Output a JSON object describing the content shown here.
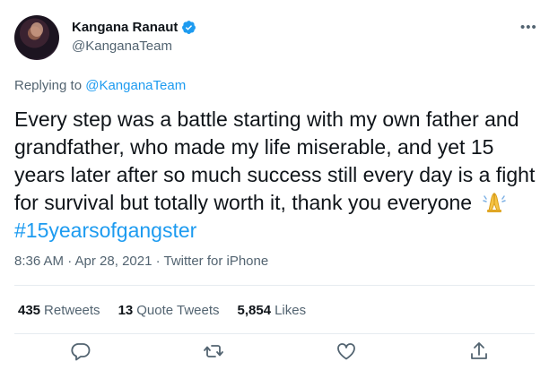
{
  "author": {
    "display_name": "Kangana Ranaut",
    "handle": "@KanganaTeam",
    "verified": true
  },
  "reply": {
    "prefix": "Replying to ",
    "mention": "@KanganaTeam"
  },
  "tweet": {
    "text": "Every step was a battle starting with my own father and grandfather, who made my life miserable, and yet 15 years later after so much success still every day is a fight for survival but totally worth it, thank you everyone",
    "emoji": "folded-hands",
    "hashtag": "#15yearsofgangster"
  },
  "meta": {
    "text": "8:36 AM · Apr 28, 2021 · Twitter for iPhone"
  },
  "stats": {
    "retweets_count": "435",
    "retweets_label": "Retweets",
    "quotes_count": "13",
    "quotes_label": "Quote Tweets",
    "likes_count": "5,854",
    "likes_label": "Likes"
  },
  "actions": [
    "reply-icon",
    "retweet-icon",
    "like-icon",
    "share-icon"
  ],
  "colors": {
    "accent": "#1d9bf0",
    "text": "#0f1419",
    "muted": "#536471",
    "divider": "#e6ecf0"
  }
}
